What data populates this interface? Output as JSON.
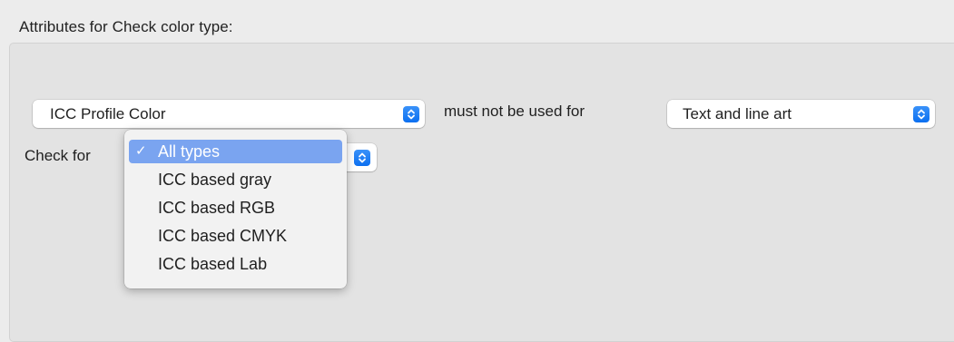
{
  "section": {
    "title": "Attributes for Check color type:"
  },
  "color_type_popup": {
    "value": "ICC Profile Color"
  },
  "must_not_label": "must not be used for",
  "usage_popup": {
    "value": "Text and line art"
  },
  "check_for": {
    "label": "Check for",
    "menu": {
      "selected_mark": "✓",
      "items": [
        {
          "label": "All types",
          "selected": true
        },
        {
          "label": "ICC based gray",
          "selected": false
        },
        {
          "label": "ICC based RGB",
          "selected": false
        },
        {
          "label": "ICC based CMYK",
          "selected": false
        },
        {
          "label": "ICC based Lab",
          "selected": false
        }
      ]
    }
  },
  "colors": {
    "accent": "#1a7cf5",
    "menu_highlight": "#7aa4f0"
  },
  "icons": {
    "popup_stepper": "chevron-up-down-icon",
    "checkmark": "checkmark-icon"
  }
}
